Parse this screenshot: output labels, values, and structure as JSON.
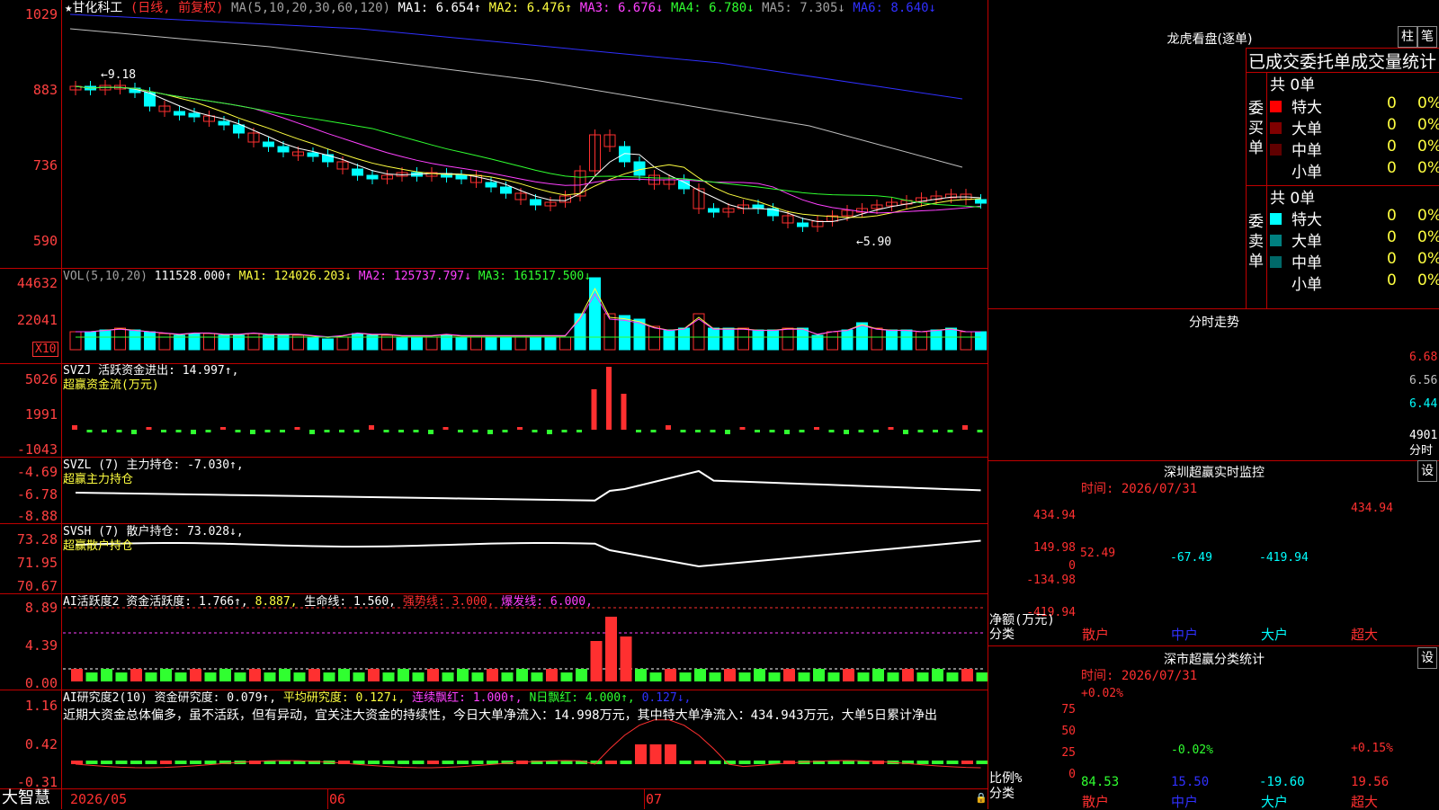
{
  "stock": {
    "title": "★甘化科工",
    "mode": "(日线, 前复权)",
    "ma_label": "MA(5,10,20,30,60,120)",
    "ma1": "MA1: 6.654↑",
    "ma2": "MA2: 6.476↑",
    "ma3": "MA3: 6.676↓",
    "ma4": "MA4: 6.780↓",
    "ma5": "MA5: 7.305↓",
    "ma6": "MA6: 8.640↓",
    "high_note": "←9.18",
    "low_note": "←5.90",
    "price_axis": [
      "1029",
      "883",
      "736",
      "590"
    ]
  },
  "vol": {
    "label": "VOL(5,10,20)",
    "value": "111528.000↑",
    "ma1": "MA1: 124026.203↓",
    "ma2": "MA2: 125737.797↓",
    "ma3": "MA3: 161517.500↓",
    "axis": [
      "44632",
      "22041"
    ],
    "unit": "X10"
  },
  "svzj": {
    "label": "SVZJ  活跃资金进出: 14.997↑,",
    "sub": "超赢资金流(万元)",
    "axis": [
      "5026",
      "1991",
      "-1043"
    ]
  },
  "svzl": {
    "label": "SVZL (7) 主力持仓: -7.030↑,",
    "sub": "超赢主力持仓",
    "axis": [
      "-4.69",
      "-6.78",
      "-8.88"
    ]
  },
  "svsh": {
    "label": "SVSH (7) 散户持仓: 73.028↓,",
    "sub": "超赢散户持仓",
    "axis": [
      "73.28",
      "71.95",
      "70.67"
    ]
  },
  "ai1": {
    "label_a": "AI活跃度2 资金活跃度: 1.766↑,",
    "label_b": "8.887,",
    "label_c": "生命线: 1.560,",
    "label_d": "强势线: 3.000,",
    "label_e": "爆发线: 6.000,",
    "axis": [
      "8.89",
      "4.39",
      "0.00"
    ]
  },
  "ai2": {
    "label_a": "AI研究度2(10) 资金研究度: 0.079↑,",
    "label_b": "平均研究度: 0.127↓,",
    "label_c": "连续飘红: 1.000↑,",
    "label_d": "N日飘红: 4.000↑,",
    "label_e": "0.127↓,",
    "comment": "近期大资金总体偏多，虽不活跃，但有异动，宜关注大资金的持续性，今日大单净流入：14.998万元，其中特大单净流入：434.943万元，大单5日累计净出",
    "axis": [
      "1.16",
      "0.42",
      "-0.31"
    ]
  },
  "dates": [
    "2026/05",
    "06",
    "07"
  ],
  "brand": "大智慧",
  "right": {
    "lhb_title": "龙虎看盘(逐单)",
    "btn1": "柱",
    "btn2": "笔",
    "tabs": "已成交委托单成交量统计",
    "buy_side": "委买单",
    "sell_side": "委卖单",
    "buy_total": "共 0单",
    "sell_total": "共 0单",
    "rows": [
      {
        "label": "特大",
        "count": "0",
        "pct": "0%"
      },
      {
        "label": "大单",
        "count": "0",
        "pct": "0%"
      },
      {
        "label": "中单",
        "count": "0",
        "pct": "0%"
      },
      {
        "label": "小单",
        "count": "0",
        "pct": "0%"
      }
    ],
    "intraday_title": "分时走势",
    "intraday_axis": [
      "6.68",
      "6.56",
      "6.44"
    ],
    "intraday_vol": "4901",
    "intraday_vol_unit": "分时",
    "monitor_title": "深圳超赢实时监控",
    "monitor_btn": "设",
    "monitor_time": "时间: 2026/07/31",
    "monitor_axis": [
      "434.94",
      "149.98",
      "0",
      "-134.98",
      "-419.94"
    ],
    "monitor_ylabel": "净额(万元)",
    "monitor_xlabel": "分类",
    "monitor_values": [
      "52.49",
      "-67.49",
      "-419.94",
      "434.94"
    ],
    "categories": [
      "散户",
      "中户",
      "大户",
      "超大"
    ],
    "stat_title": "深市超赢分类统计",
    "stat_btn": "设",
    "stat_time": "时间: 2026/07/31",
    "stat_axis": [
      "75",
      "50",
      "25",
      "0"
    ],
    "stat_ylabel": "比例%",
    "stat_xlabel": "分类",
    "stat_top": [
      "+0.02%",
      "-0.02%",
      "",
      "+0.15%"
    ],
    "stat_bottom": [
      "84.53",
      "15.50",
      "-19.60",
      "19.56"
    ]
  },
  "colors": {
    "up": "#ff3030",
    "down": "#00ffff",
    "grid": "#c00000",
    "ma1": "#ffffff",
    "ma2": "#ffff40",
    "ma3": "#ff40ff",
    "ma4": "#30ff30",
    "ma5": "#c0c0c0",
    "ma6": "#3030ff"
  }
}
